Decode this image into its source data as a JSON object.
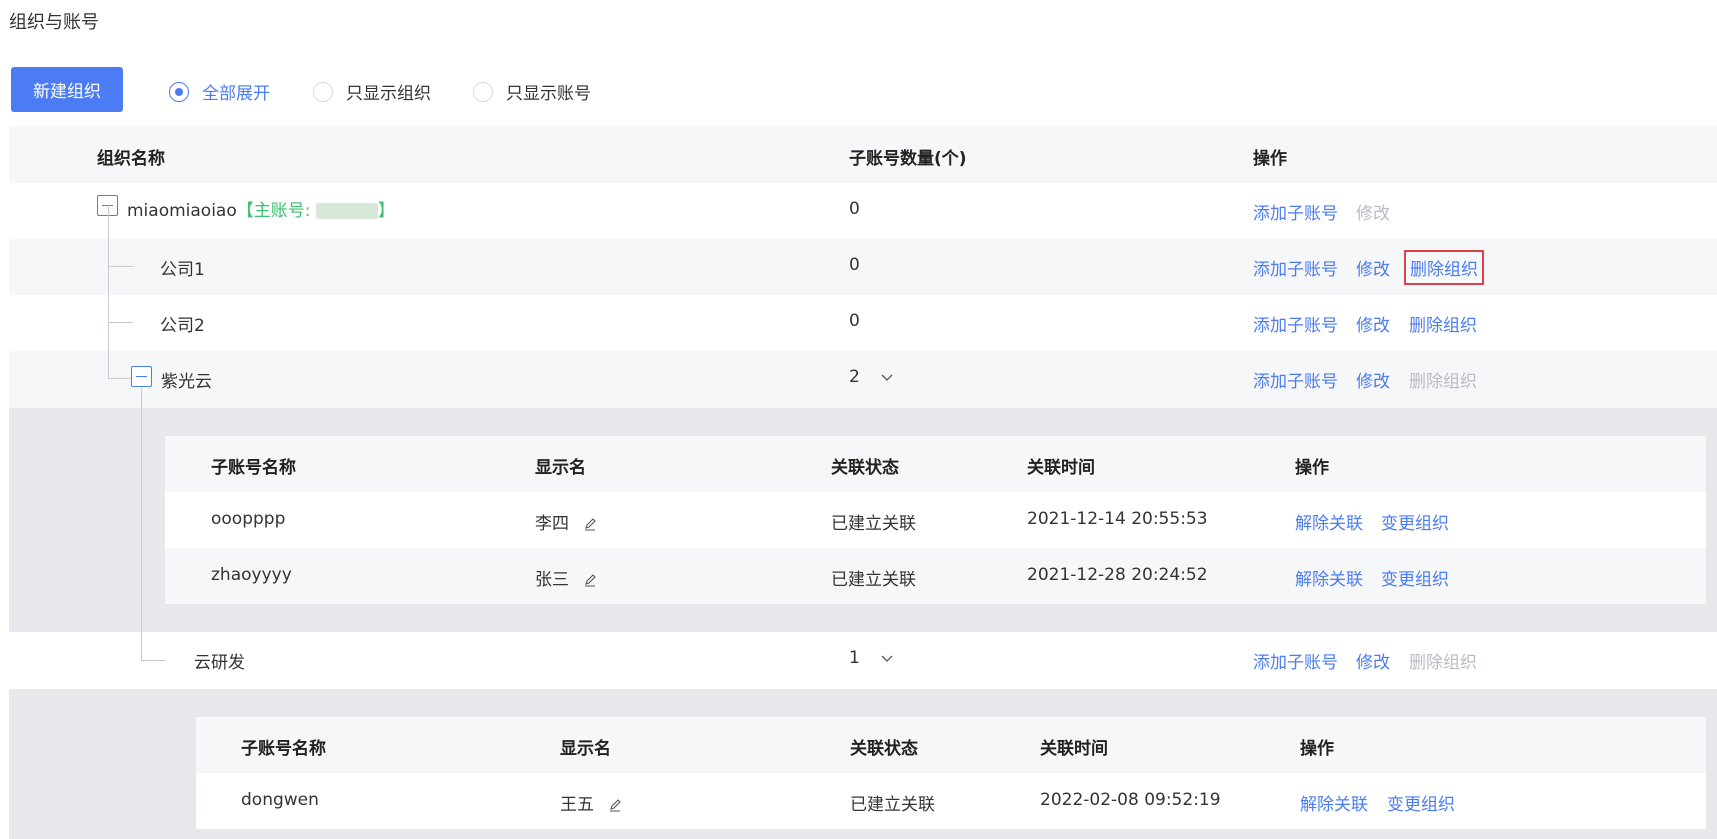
{
  "page": {
    "title": "组织与账号"
  },
  "toolbar": {
    "new_org_label": "新建组织",
    "radios": [
      {
        "label": "全部展开",
        "checked": true
      },
      {
        "label": "只显示组织",
        "checked": false
      },
      {
        "label": "只显示账号",
        "checked": false
      }
    ]
  },
  "main_table": {
    "headers": {
      "name": "组织名称",
      "count": "子账号数量(个)",
      "ops": "操作"
    },
    "root": {
      "name": "miaomiaoiao",
      "primary_account_prefix": "【主账号:",
      "primary_account_suffix": "】",
      "count": "0",
      "ops": {
        "add": "添加子账号",
        "edit": "修改"
      }
    },
    "rows": [
      {
        "name": "公司1",
        "count": "0",
        "ops": {
          "add": "添加子账号",
          "edit": "修改",
          "delete": "删除组织"
        }
      },
      {
        "name": "公司2",
        "count": "0",
        "ops": {
          "add": "添加子账号",
          "edit": "修改",
          "delete": "删除组织"
        }
      },
      {
        "name": "紫光云",
        "count": "2",
        "ops": {
          "add": "添加子账号",
          "edit": "修改",
          "delete": "删除组织"
        }
      },
      {
        "name": "云研发",
        "count": "1",
        "ops": {
          "add": "添加子账号",
          "edit": "修改",
          "delete": "删除组织"
        }
      }
    ]
  },
  "sub_tables": [
    {
      "headers": {
        "name": "子账号名称",
        "display": "显示名",
        "status": "关联状态",
        "time": "关联时间",
        "ops": "操作"
      },
      "rows": [
        {
          "name": "ooopppp",
          "display": "李四",
          "status": "已建立关联",
          "time": "2021-12-14 20:55:53",
          "unlink": "解除关联",
          "change": "变更组织"
        },
        {
          "name": "zhaoyyyy",
          "display": "张三",
          "status": "已建立关联",
          "time": "2021-12-28 20:24:52",
          "unlink": "解除关联",
          "change": "变更组织"
        }
      ]
    },
    {
      "headers": {
        "name": "子账号名称",
        "display": "显示名",
        "status": "关联状态",
        "time": "关联时间",
        "ops": "操作"
      },
      "rows": [
        {
          "name": "dongwen",
          "display": "王五",
          "status": "已建立关联",
          "time": "2022-02-08 09:52:19",
          "unlink": "解除关联",
          "change": "变更组织"
        }
      ]
    }
  ],
  "colors": {
    "primary": "#4b7cf3",
    "green": "#3cbf6f",
    "disabled": "#b8bcc4",
    "highlight_border": "#e0404a"
  }
}
